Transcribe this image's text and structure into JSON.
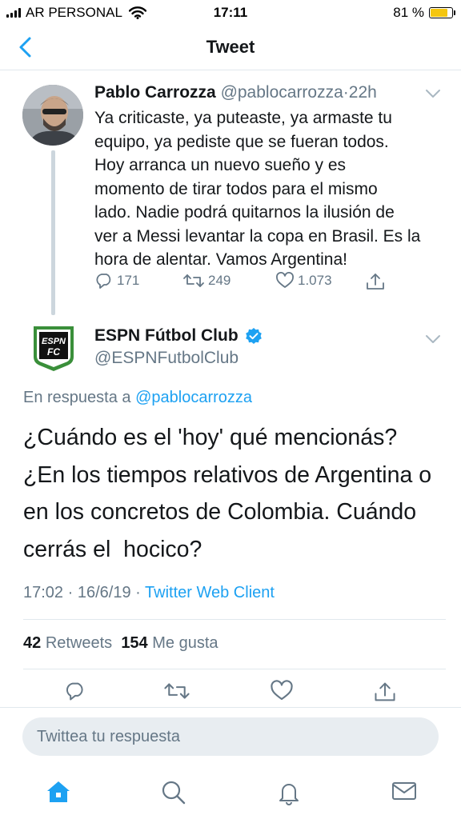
{
  "status_bar": {
    "carrier": "AR PERSONAL",
    "time": "17:11",
    "battery": "81 %",
    "battery_level": 0.81,
    "battery_color": "#f5c60f"
  },
  "nav": {
    "title": "Tweet",
    "back_icon": "chevron-left-icon"
  },
  "parent_tweet": {
    "name": "Pablo Carrozza",
    "handle": "@pablocarrozza",
    "separator": "·",
    "age": "22h",
    "lines": [
      "Ya criticaste, ya puteaste, ya armaste tu",
      "equipo, ya pediste que se fueran todos.",
      "Hoy arranca un nuevo sueño y es",
      "momento de tirar todos para el mismo",
      "lado. Nadie podrá quitarnos la ilusión de",
      "ver a Messi levantar la copa en Brasil. Es la",
      "hora de alentar. Vamos Argentina!"
    ],
    "replies": "171",
    "retweets": "249",
    "likes": "1.073"
  },
  "reply_tweet": {
    "name": "ESPN Fútbol Club",
    "handle": "@ESPNFutbolClub",
    "logo_text_top": "ESPN",
    "logo_text_bottom": "FC",
    "reply_prefix": "En respuesta a",
    "reply_mention": "@pablocarrozza",
    "lines": [
      "¿Cuándo es el 'hoy' qué mencionás?",
      "¿En los tiempos relativos de Argentina o",
      "en los concretos de Colombia. Cuándo",
      "cerrás el  hocico?"
    ],
    "time": "17:02",
    "dot": "·",
    "date": "16/6/19",
    "client": "Twitter Web Client",
    "retweets_count": "42",
    "retweets_label": "Retweets",
    "likes_count": "154",
    "likes_label": "Me gusta"
  },
  "compose": {
    "placeholder": "Twittea tu respuesta"
  },
  "tabs": [
    "home-icon",
    "search-icon",
    "notifications-icon",
    "messages-icon"
  ],
  "colors": {
    "accent": "#1da1f2",
    "secondary_text": "#657786",
    "espn_green": "#3a8f3a"
  }
}
